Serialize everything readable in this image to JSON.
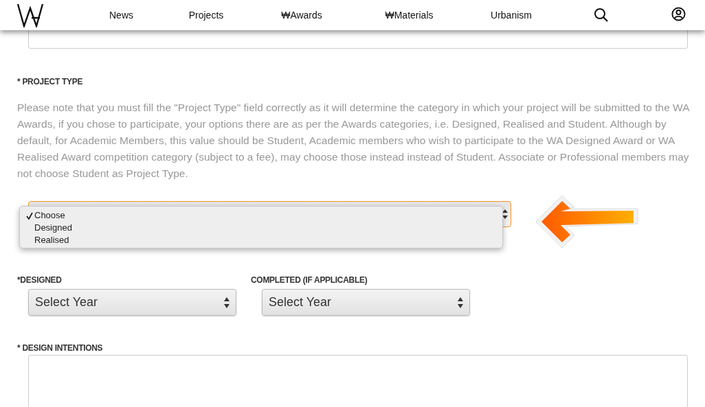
{
  "nav": {
    "items": [
      {
        "label": "News"
      },
      {
        "label": "Projects"
      },
      {
        "label": "₩Awards"
      },
      {
        "label": "₩Materials"
      },
      {
        "label": "Urbanism"
      }
    ]
  },
  "project_type": {
    "label": "* PROJECT TYPE",
    "note": "Please note that you must fill the \"Project Type\" field correctly as it will determine the category in which your project will be submitted to the WA Awards, if you chose to participate, your options there are as per the Awards categories, i.e. Designed, Realised and Student. Although by default, for Academic Members, this value should be Student, Academic members who wish to participate to the WA Designed Award or WA Realised Award competition category (subject to a fee), may choose those instead instead of Student. Associate or Professional members may not choose Student as Project Type.",
    "dropdown": {
      "expanded": true,
      "options": [
        {
          "label": "Choose",
          "selected": true
        },
        {
          "label": "Designed",
          "selected": false
        },
        {
          "label": "Realised",
          "selected": false
        }
      ]
    }
  },
  "years": [
    {
      "label": "*DESIGNED",
      "value": "Select Year"
    },
    {
      "label": "COMPLETED (IF APPLICABLE)",
      "value": "Select Year"
    }
  ],
  "design_intentions": {
    "label": "* DESIGN INTENTIONS"
  }
}
